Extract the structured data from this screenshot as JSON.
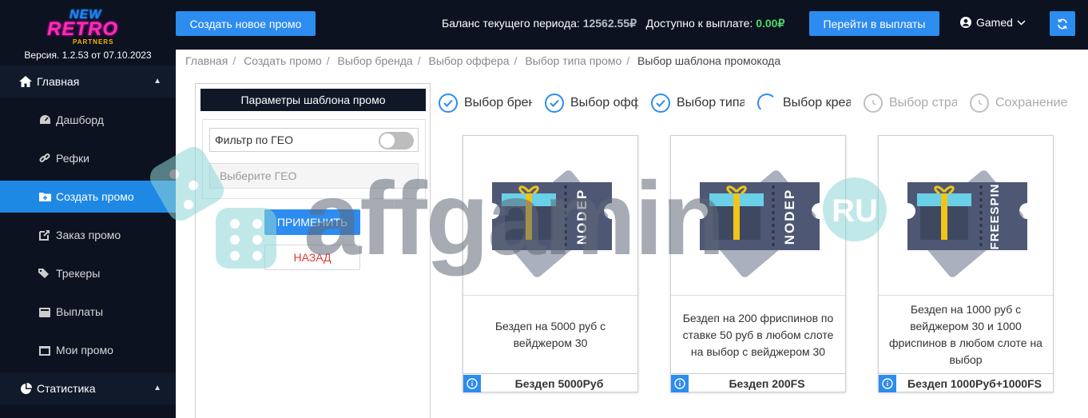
{
  "logo": {
    "line1": "NEW",
    "line2": "RETRO",
    "line3": "PARTNERS"
  },
  "version": "Версия. 1.2.53 от 07.10.2023",
  "sidebar": {
    "sections": [
      {
        "label": "Главная",
        "icon": "home-icon"
      },
      {
        "label": "Статистика",
        "icon": "pie-chart-icon"
      }
    ],
    "items": [
      {
        "label": "Дашборд",
        "icon": "dashboard-icon"
      },
      {
        "label": "Рефки",
        "icon": "link-icon"
      },
      {
        "label": "Создать промо",
        "icon": "folder-plus-icon",
        "active": true
      },
      {
        "label": "Заказ промо",
        "icon": "external-link-icon"
      },
      {
        "label": "Трекеры",
        "icon": "tags-icon"
      },
      {
        "label": "Выплаты",
        "icon": "wallet-icon"
      },
      {
        "label": "Мои промо",
        "icon": "image-icon"
      }
    ]
  },
  "topbar": {
    "create_button": "Создать новое промо",
    "balance_label": "Баланс текущего периода:",
    "balance_value": "12562.55₽",
    "available_label": "Доступно к выплате:",
    "available_value": "0.00₽",
    "payout_button": "Перейти в выплаты",
    "user_name": "Gamed"
  },
  "breadcrumb": [
    "Главная",
    "Создать промо",
    "Выбор бренда",
    "Выбор оффера",
    "Выбор типа промо",
    "Выбор шаблона промокода"
  ],
  "panel": {
    "title": "Параметры шаблона промо",
    "geo_filter_label": "Фильтр по ГЕО",
    "geo_placeholder": "Выберите ГЕО",
    "apply_button": "ПРИМЕНИТЬ",
    "back_button": "НАЗАД"
  },
  "steps": [
    {
      "label": "Выбор бренда",
      "state": "done"
    },
    {
      "label": "Выбор оффера",
      "state": "done"
    },
    {
      "label": "Выбор типа промо",
      "state": "done"
    },
    {
      "label": "Выбор креатива",
      "state": "current"
    },
    {
      "label": "Выбор страницы",
      "state": "pending"
    },
    {
      "label": "Сохранение",
      "state": "pending"
    }
  ],
  "cards": [
    {
      "ticket_text": "NODEP",
      "description": "Бездеп на 5000 руб с вейджером 30",
      "name": "Бездеп 5000Руб"
    },
    {
      "ticket_text": "NODEP",
      "description": "Бездеп на 200 фриспинов по ставке 50 руб в любом слоте на выбор с вейджером 30",
      "name": "Бездеп 200FS"
    },
    {
      "ticket_text": "FREESPIN",
      "description": "Бездеп на 1000 руб с вейджером 30 и 1000 фриспинов в любом слоте на выбор",
      "name": "Бездеп 1000Руб+1000FS"
    }
  ],
  "watermark": {
    "text": "affgamin",
    "badge": "RU"
  },
  "colors": {
    "accent": "#2d8cf0",
    "sidebar_bg": "#0c1220",
    "success": "#4cd964",
    "danger": "#e53935"
  }
}
